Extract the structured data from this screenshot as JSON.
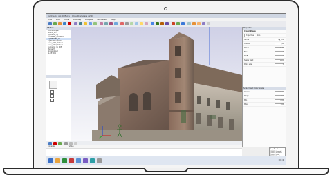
{
  "window": {
    "title": "hydraulic_rig_005.ply - CloudCompare v2.9"
  },
  "menu": [
    "File",
    "Edit",
    "Tools",
    "Display",
    "Plugins",
    "3D Views",
    "Help"
  ],
  "db_tree": {
    "header": "DB Tree",
    "items": [
      "CloudCompare",
      "Solaris_1.3",
      "hydraulic_rig",
      "SCANNED_GRAPHICS",
      "[v] MERGED_01",
      "[v] PARTIAL_NEW",
      "Scan_0001_texture",
      "Scan_0002_texture",
      "hydraulic_rig_005",
      "Merge_fix",
      "global_offset",
      "SLICE_001"
    ]
  },
  "properties": {
    "header": "Properties",
    "section": "Cloud Shape",
    "tabs": [
      "Properties",
      "Info"
    ],
    "rows": [
      {
        "label": "Name",
        "value": "rig_005"
      },
      {
        "label": "Visible",
        "value": "yes"
      },
      {
        "label": "Points",
        "value": "1.2M"
      },
      {
        "label": "Box",
        "value": "3.5"
      },
      {
        "label": "Shift",
        "value": "0.0"
      },
      {
        "label": "Scalar field",
        "value": "none"
      },
      {
        "label": "Point size",
        "value": "2"
      }
    ],
    "section2": "Scalar Field Color Scale",
    "rows2": [
      {
        "label": "Current",
        "value": "Default"
      },
      {
        "label": "Steps",
        "value": "256"
      },
      {
        "label": "Min",
        "value": "0.00"
      },
      {
        "label": "Max",
        "value": "1.00"
      }
    ]
  },
  "console": {
    "header": "Console",
    "col_label": "Value"
  },
  "log_panel": {
    "header": "Log Panel",
    "lines": [
      "[10:21] Loaded",
      "[10:22] Merged",
      "[10:22] Done",
      "[10:23] Saved"
    ]
  },
  "taskbar": {
    "clock": "10:24"
  },
  "colors": {
    "accent": "#3f6fb5",
    "titlebar": "#cfd6e2",
    "taskbar": "#dfe6f1"
  }
}
